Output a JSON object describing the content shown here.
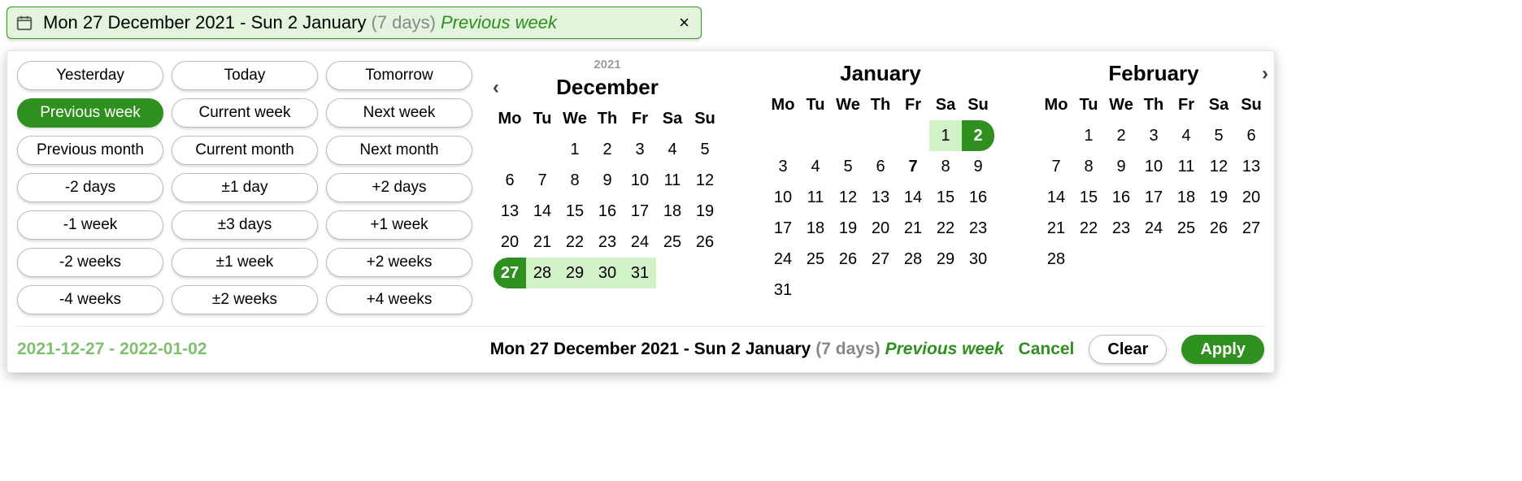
{
  "input": {
    "range_text": "Mon 27 December 2021 - Sun 2 January",
    "days_text": "(7 days)",
    "preset_text": "Previous week",
    "close_glyph": "×"
  },
  "presets": {
    "rows": [
      [
        "Yesterday",
        "Today",
        "Tomorrow"
      ],
      [
        "Previous week",
        "Current week",
        "Next week"
      ],
      [
        "Previous month",
        "Current month",
        "Next month"
      ],
      [
        "-2 days",
        "±1 day",
        "+2 days"
      ],
      [
        "-1 week",
        "±3 days",
        "+1 week"
      ],
      [
        "-2 weeks",
        "±1 week",
        "+2 weeks"
      ],
      [
        "-4 weeks",
        "±2 weeks",
        "+4 weeks"
      ]
    ],
    "active": "Previous week"
  },
  "calendar": {
    "dow": [
      "Mo",
      "Tu",
      "We",
      "Th",
      "Fr",
      "Sa",
      "Su"
    ],
    "nav_prev": "‹",
    "nav_next": "›",
    "months": [
      {
        "title": "December",
        "year_label": "2021",
        "show_year": true,
        "show_prev": true,
        "show_next": false,
        "leading_blanks": 2,
        "num_days": 31,
        "range_start": 27,
        "range_end_inclusive": 31,
        "is_end_month": false,
        "today": null
      },
      {
        "title": "January",
        "show_year": false,
        "show_prev": false,
        "show_next": false,
        "leading_blanks": 5,
        "num_days": 31,
        "range_start": 1,
        "range_end_inclusive": 2,
        "is_end_month": true,
        "today": 7
      },
      {
        "title": "February",
        "show_year": false,
        "show_prev": false,
        "show_next": true,
        "leading_blanks": 1,
        "num_days": 28,
        "range_start": null,
        "range_end_inclusive": null,
        "is_end_month": false,
        "today": null
      }
    ]
  },
  "footer": {
    "iso_range": "2021-12-27 - 2022-01-02",
    "range_text": "Mon 27 December 2021 - Sun 2 January",
    "days_text": "(7 days)",
    "preset_text": "Previous week",
    "cancel": "Cancel",
    "clear": "Clear",
    "apply": "Apply"
  }
}
